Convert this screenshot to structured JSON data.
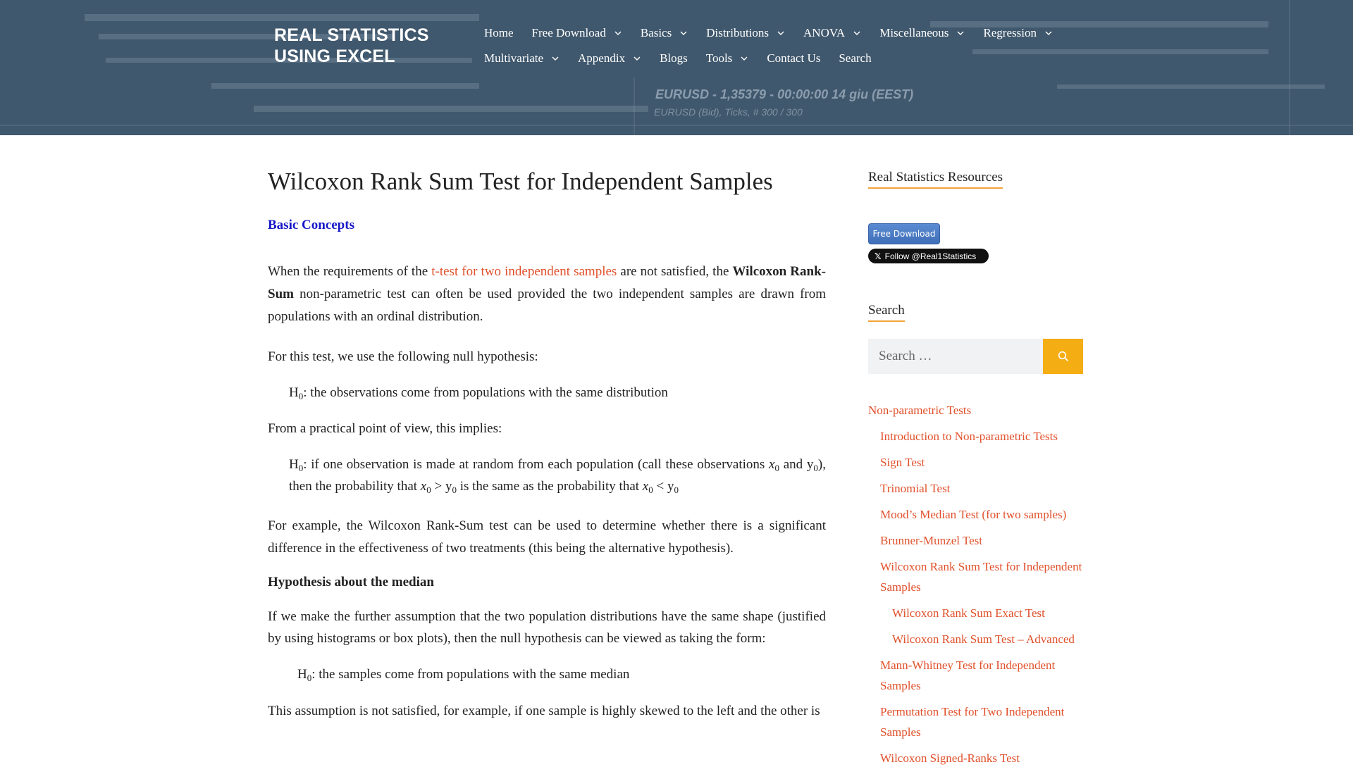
{
  "header": {
    "brand_line1": "REAL STATISTICS",
    "brand_line2": "USING EXCEL",
    "background_text": "EURUSD - 1,35379 - 00:00:00  14 giu (EEST)",
    "background_text2": "EURUSD (Bid), Ticks, # 300 / 300",
    "nav_row1": [
      {
        "label": "Home",
        "dropdown": false
      },
      {
        "label": "Free Download",
        "dropdown": true
      },
      {
        "label": "Basics",
        "dropdown": true
      },
      {
        "label": "Distributions",
        "dropdown": true
      },
      {
        "label": "ANOVA",
        "dropdown": true
      },
      {
        "label": "Miscellaneous",
        "dropdown": true
      },
      {
        "label": "Regression",
        "dropdown": true
      }
    ],
    "nav_row2": [
      {
        "label": "Multivariate",
        "dropdown": true
      },
      {
        "label": "Appendix",
        "dropdown": true
      },
      {
        "label": "Blogs",
        "dropdown": false
      },
      {
        "label": "Tools",
        "dropdown": true
      },
      {
        "label": "Contact Us",
        "dropdown": false
      },
      {
        "label": "Search",
        "dropdown": false
      }
    ]
  },
  "article": {
    "title": "Wilcoxon Rank Sum Test for Independent Samples",
    "section_link": "Basic Concepts",
    "p1_a": "When the requirements of the ",
    "p1_link": "t-test for two independent samples",
    "p1_b": " are not satisfied, the ",
    "p1_bold": "Wilcoxon Rank-Sum",
    "p1_c": " non-parametric test can often be used provided the two independent samples are drawn from populations with an ordinal distribution.",
    "p2": "For this test, we use the following null hypothesis:",
    "h0_1_H": "H",
    "h0_1_sub": "0",
    "h0_1_text": ": the observations come from populations with the same distribution",
    "p3": "From a practical point of view, this implies:",
    "h0_2_H": "H",
    "h0_2_sub": "0",
    "h0_2_a": ": if one observation is made at random from each population (call these observations ",
    "h0_2_x": "x",
    "h0_2_x_sub": "0",
    "h0_2_and": " and y",
    "h0_2_y_sub": "0",
    "h0_2_b": "), then the probability that ",
    "h0_2_x2": "x",
    "h0_2_x2_sub": "0",
    "h0_2_gt": " > y",
    "h0_2_y2_sub": "0",
    "h0_2_c": " is the same as the probability that ",
    "h0_2_x3": "x",
    "h0_2_x3_sub": "0",
    "h0_2_lt": " < y",
    "h0_2_y3_sub": "0",
    "p4": "For example, the Wilcoxon Rank-Sum test can be used to determine whether there is a significant difference in the effectiveness of two treatments (this being the alternative hypothesis).",
    "subheading": "Hypothesis about the median",
    "p5": "If we make the further assumption that the two population distributions have the same shape (justified by using histograms or box plots), then the null hypothesis can be viewed as taking the form:",
    "h0_3_H": "H",
    "h0_3_sub": "0",
    "h0_3_text": ": the samples come from populations with the same median",
    "p6": "This assumption is not satisfied, for example, if one sample is highly skewed to the left and the other is"
  },
  "sidebar": {
    "resources_title": "Real Statistics Resources",
    "download_button": "Free Download",
    "twitter_button": "Follow @Real1Statistics",
    "search_title": "Search",
    "search_placeholder": "Search …",
    "nav": [
      {
        "label": "Non-parametric Tests",
        "level": 0
      },
      {
        "label": "Introduction to Non-parametric Tests",
        "level": 1
      },
      {
        "label": "Sign Test",
        "level": 1
      },
      {
        "label": "Trinomial Test",
        "level": 1
      },
      {
        "label": "Mood’s Median Test (for two samples)",
        "level": 1
      },
      {
        "label": "Brunner-Munzel Test",
        "level": 1
      },
      {
        "label": "Wilcoxon Rank Sum Test for Independent Samples",
        "level": 1
      },
      {
        "label": "Wilcoxon Rank Sum Exact Test",
        "level": 2
      },
      {
        "label": "Wilcoxon Rank Sum Test – Advanced",
        "level": 2
      },
      {
        "label": "Mann-Whitney Test for Independent Samples",
        "level": 1
      },
      {
        "label": "Permutation Test for Two Independent Samples",
        "level": 1
      },
      {
        "label": "Wilcoxon Signed-Ranks Test",
        "level": 1
      }
    ]
  },
  "colors": {
    "header_bg": "#455d72",
    "link_orange": "#e0502a",
    "section_blue": "#1515c8",
    "search_button": "#f4ad13",
    "widget_underline": "#f4a23a"
  }
}
